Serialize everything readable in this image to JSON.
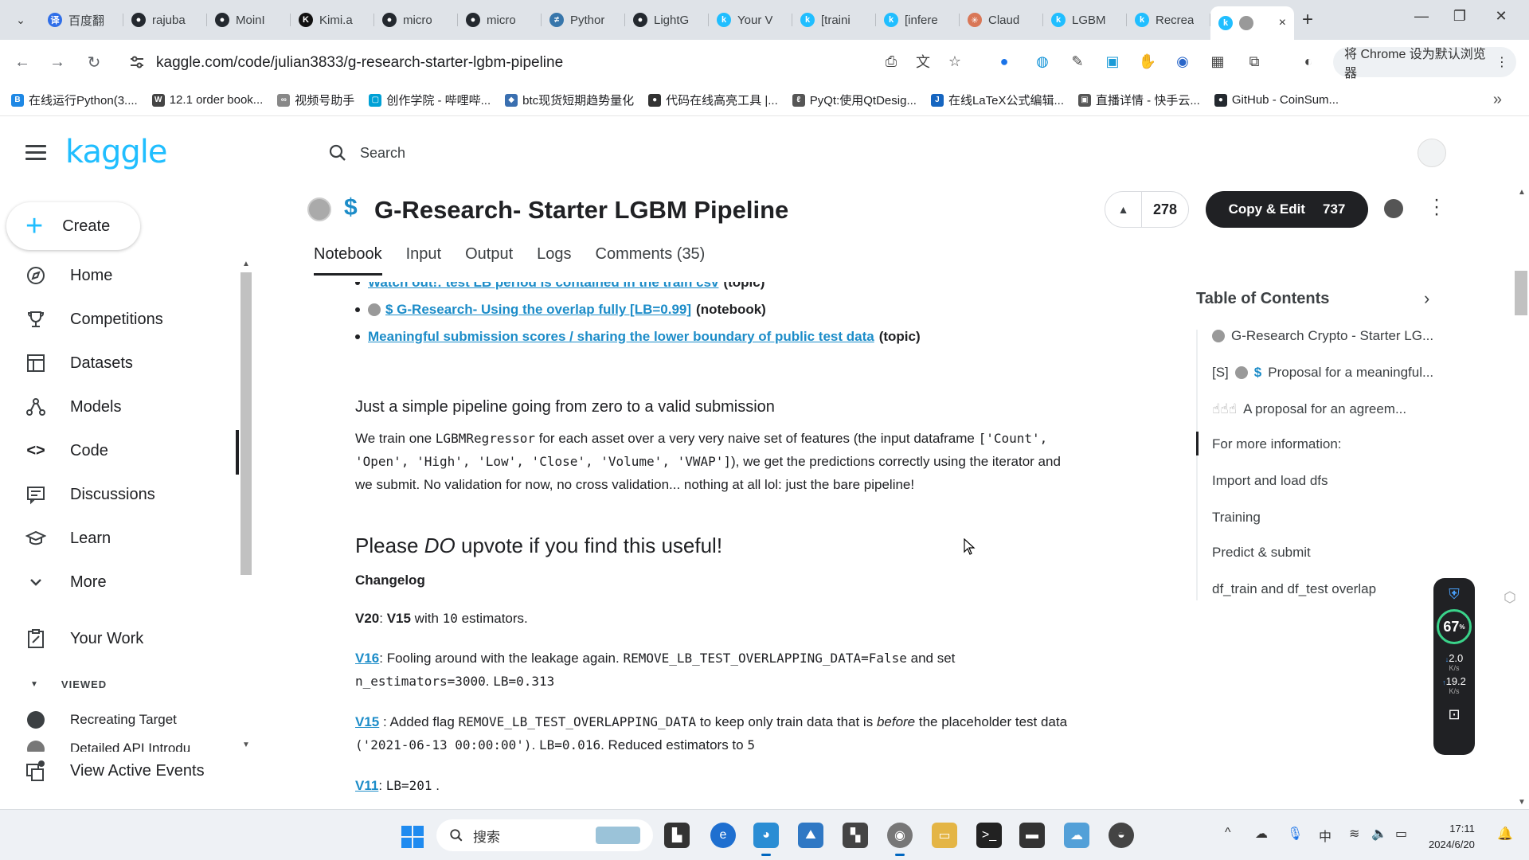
{
  "browser": {
    "tabs": [
      {
        "title": "百度翻",
        "icon": "baidu-translate-icon",
        "color": "#2f6ee8",
        "glyph": "译"
      },
      {
        "title": "rajuba",
        "icon": "github-icon",
        "color": "#24292f",
        "glyph": "●"
      },
      {
        "title": "MoinI",
        "icon": "github-icon",
        "color": "#24292f",
        "glyph": "●"
      },
      {
        "title": "Kimi.a",
        "icon": "kimi-icon",
        "color": "#111111",
        "glyph": "K"
      },
      {
        "title": "micro",
        "icon": "github-icon",
        "color": "#24292f",
        "glyph": "●"
      },
      {
        "title": "micro",
        "icon": "github-icon",
        "color": "#24292f",
        "glyph": "●"
      },
      {
        "title": "Pythor",
        "icon": "python-icon",
        "color": "#3776ab",
        "glyph": "≠"
      },
      {
        "title": "LightG",
        "icon": "github-icon",
        "color": "#24292f",
        "glyph": "●"
      },
      {
        "title": "Your V",
        "icon": "kaggle-icon",
        "color": "#20beff",
        "glyph": "k"
      },
      {
        "title": "[traini",
        "icon": "kaggle-icon",
        "color": "#20beff",
        "glyph": "k"
      },
      {
        "title": "[infere",
        "icon": "kaggle-icon",
        "color": "#20beff",
        "glyph": "k"
      },
      {
        "title": "Claud",
        "icon": "claude-icon",
        "color": "#d97757",
        "glyph": "✳"
      },
      {
        "title": "LGBM",
        "icon": "kaggle-icon",
        "color": "#20beff",
        "glyph": "k"
      },
      {
        "title": "Recrea",
        "icon": "kaggle-icon",
        "color": "#20beff",
        "glyph": "k"
      }
    ],
    "active_tab_close": "×",
    "new_tab": "+",
    "url": "kaggle.com/code/julian3833/g-research-starter-lgbm-pipeline",
    "default_browser_label": "将 Chrome 设为默认浏览器",
    "bookmarks": [
      {
        "label": "在线运行Python(3....",
        "color": "#1e88e5",
        "glyph": "B"
      },
      {
        "label": "12.1 order book...",
        "color": "#444444",
        "glyph": "W"
      },
      {
        "label": "视频号助手",
        "color": "#888888",
        "glyph": "∞"
      },
      {
        "label": "创作学院 - 哔哩哔...",
        "color": "#00a1d6",
        "glyph": "▢"
      },
      {
        "label": "btc现货短期趋势量化",
        "color": "#3a6fb0",
        "glyph": "◆"
      },
      {
        "label": "代码在线高亮工具 |...",
        "color": "#333333",
        "glyph": "●"
      },
      {
        "label": "PyQt:使用QtDesig...",
        "color": "#555555",
        "glyph": "ℓ"
      },
      {
        "label": "在线LaTeX公式编辑...",
        "color": "#1565c0",
        "glyph": "J"
      },
      {
        "label": "直播详情 - 快手云...",
        "color": "#555555",
        "glyph": "▣"
      },
      {
        "label": "GitHub - CoinSum...",
        "color": "#24292f",
        "glyph": "●"
      }
    ]
  },
  "kaggle": {
    "logo": "kaggle",
    "search_placeholder": "Search",
    "create_label": "Create",
    "nav": [
      {
        "label": "Home",
        "name": "home"
      },
      {
        "label": "Competitions",
        "name": "competitions"
      },
      {
        "label": "Datasets",
        "name": "datasets"
      },
      {
        "label": "Models",
        "name": "models"
      },
      {
        "label": "Code",
        "name": "code"
      },
      {
        "label": "Discussions",
        "name": "discussions"
      },
      {
        "label": "Learn",
        "name": "learn"
      },
      {
        "label": "More",
        "name": "more"
      }
    ],
    "your_work": "Your Work",
    "viewed_label": "VIEWED",
    "viewed": [
      "Recreating Target",
      "Detailed API Introdu"
    ],
    "view_active_events": "View Active Events"
  },
  "notebook": {
    "dollar": "$",
    "title": "G-Research- Starter LGBM Pipeline",
    "votes": "278",
    "copy_edit_label": "Copy & Edit",
    "copy_edit_count": "737",
    "tabs": [
      "Notebook",
      "Input",
      "Output",
      "Logs",
      "Comments (35)"
    ],
    "links": [
      {
        "text": "Watch out!: test LB period is contained in the train csv",
        "tag": "(topic)",
        "prefix": ""
      },
      {
        "text": "$  G-Research- Using the overlap fully [LB=0.99]",
        "tag": "(notebook)",
        "prefix": "avatar"
      },
      {
        "text": "Meaningful submission scores / sharing the lower boundary of public test data",
        "tag": "(topic)",
        "prefix": ""
      }
    ],
    "section_title": "Just a simple pipeline going from zero to a valid submission",
    "intro": {
      "p1": "We train one ",
      "regressor": "LGBMRegressor",
      "p2": " for each asset over a very very naive set of features (the input dataframe ",
      "cols_a": "['Count',",
      "cols_b": "'Open', 'High', 'Low', 'Close', 'Volume', 'VWAP']",
      "p3": "), we get the predictions correctly using the iterator and",
      "p4": "we submit. No validation for now, no cross validation... nothing at all lol: just the bare pipeline!"
    },
    "upvote": {
      "pre": "Please ",
      "em": "DO",
      "post": " upvote if you find this useful!"
    },
    "changelog_label": "Changelog",
    "v20": {
      "ver": "V20",
      "sep": ": ",
      "ref": "V15",
      "mid": " with ",
      "code": "10",
      "post": " estimators."
    },
    "v16": {
      "ver": "V16",
      "t1": ": Fooling around with the leakage again. ",
      "c1": "REMOVE_LB_TEST_OVERLAPPING_DATA=False",
      "t2": " and set",
      "c2": "n_estimators=3000",
      "t3": ". ",
      "c3": "LB=0.313"
    },
    "v15": {
      "ver": "V15",
      "t1": " : Added flag ",
      "c1": "REMOVE_LB_TEST_OVERLAPPING_DATA",
      "t2": " to keep only train data that is ",
      "em": "before",
      "t3": " the placeholder test data",
      "c2": "('2021-06-13 00:00:00')",
      "t4": ". ",
      "c3": "LB=0.016",
      "t5": ". Reduced estimators to ",
      "c4": "5"
    },
    "v11": {
      "ver": "V11",
      "t1": ": ",
      "c1": "LB=201",
      "t2": " ."
    }
  },
  "toc": {
    "title": "Table of Contents",
    "items": [
      {
        "text": "G-Research Crypto - Starter LG...",
        "prefix": "avatar"
      },
      {
        "text": "Proposal for a meaningful...",
        "prefix": "[S] avatar $"
      },
      {
        "text": "A proposal for an agreem...",
        "prefix": "hands"
      },
      {
        "text": "For more information:",
        "prefix": ""
      },
      {
        "text": "Import and load dfs",
        "prefix": ""
      },
      {
        "text": "Training",
        "prefix": ""
      },
      {
        "text": "Predict & submit",
        "prefix": ""
      },
      {
        "text": "df_train and df_test overlap",
        "prefix": ""
      }
    ],
    "s_prefix": "[S]",
    "dollar": "$"
  },
  "speed_widget": {
    "percent": "67",
    "percent_unit": "%",
    "down": "2.0",
    "up": "19.2",
    "unit": "K/s"
  },
  "taskbar": {
    "search": "搜索",
    "time": "17:11",
    "date": "2024/6/20",
    "ime": "中"
  }
}
